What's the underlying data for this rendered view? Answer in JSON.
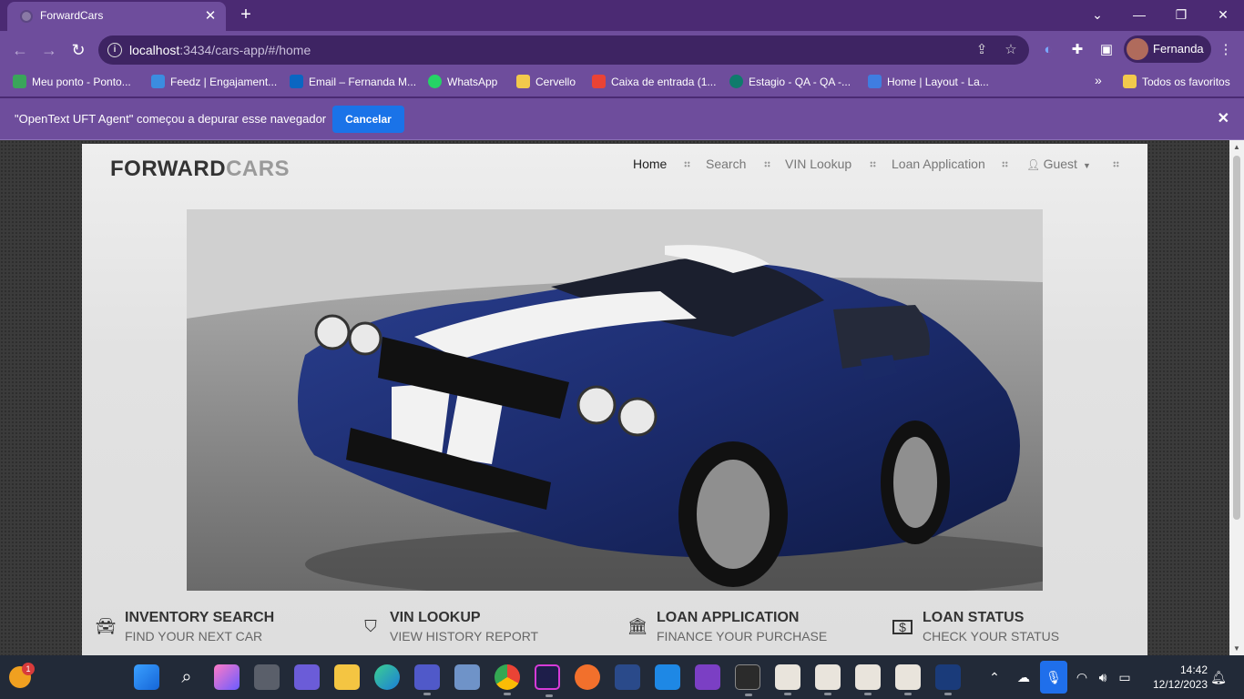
{
  "browser": {
    "tab_title": "ForwardCars",
    "url_host": "localhost",
    "url_path": ":3434/cars-app/#/home",
    "profile_name": "Fernanda"
  },
  "bookmarks": [
    {
      "label": "Meu ponto - Ponto...",
      "color": "#3aa55a"
    },
    {
      "label": "Feedz | Engajament...",
      "color": "#3b8de0"
    },
    {
      "label": "Email – Fernanda M...",
      "color": "#0a66c2"
    },
    {
      "label": "WhatsApp",
      "color": "#25d366"
    },
    {
      "label": "Cervello",
      "color": "#f2c94c"
    },
    {
      "label": "Caixa de entrada (1...",
      "color": "#ea4335"
    },
    {
      "label": "Estagio - QA - QA -...",
      "color": "#0f7b6c"
    },
    {
      "label": "Home | Layout - La...",
      "color": "#3f7de0"
    }
  ],
  "bookmarks_more": "»",
  "bookmarks_all": "Todos os favoritos",
  "infobar": {
    "message": "\"OpenText UFT Agent\" começou a depurar esse navegador",
    "cancel_label": "Cancelar"
  },
  "site": {
    "logo_part1": "FORWARD",
    "logo_part2": "CARS",
    "nav": [
      "Home",
      "Search",
      "VIN Lookup",
      "Loan Application"
    ],
    "user_menu": "Guest",
    "features": [
      {
        "title": "INVENTORY SEARCH",
        "subtitle": "FIND YOUR NEXT CAR",
        "icon": "car-icon"
      },
      {
        "title": "VIN LOOKUP",
        "subtitle": "VIEW HISTORY REPORT",
        "icon": "road-icon"
      },
      {
        "title": "LOAN APPLICATION",
        "subtitle": "FINANCE YOUR PURCHASE",
        "icon": "bank-icon"
      },
      {
        "title": "LOAN STATUS",
        "subtitle": "CHECK YOUR STATUS",
        "icon": "money-icon"
      }
    ]
  },
  "taskbar": {
    "time": "14:42",
    "date": "12/12/2023",
    "weather_badge": "1"
  }
}
